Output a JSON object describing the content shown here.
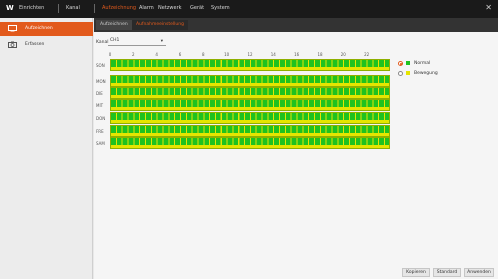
{
  "topnav": {
    "logo": "W",
    "items": [
      "Einrichten",
      "Kanal",
      "Aufzeichnung",
      "Alarm",
      "Netzwerk",
      "Gerät",
      "System"
    ],
    "active": "Aufzeichnung",
    "close_icon": "close-icon"
  },
  "sidebar": {
    "items": [
      {
        "label": "Aufzeichnen",
        "icon": "record-icon",
        "active": true
      },
      {
        "label": "Erfassen",
        "icon": "camera-icon",
        "active": false
      }
    ]
  },
  "subtabs": [
    {
      "label": "Aufzeichnen",
      "active": false
    },
    {
      "label": "Aufnahmeeinstellung",
      "active": true
    }
  ],
  "schedule": {
    "channel_label": "Kanal",
    "channel_value": "CH1",
    "hours": [
      "0",
      "2",
      "4",
      "6",
      "8",
      "10",
      "12",
      "14",
      "16",
      "18",
      "20",
      "22"
    ],
    "days": [
      "SON",
      "MON",
      "DIE",
      "MIT",
      "DON",
      "FRE",
      "SAM"
    ]
  },
  "legend": [
    {
      "label": "Normal",
      "color": "#1fc21f",
      "selected": true
    },
    {
      "label": "Bewegung",
      "color": "#e5e500",
      "selected": false
    }
  ],
  "footer": {
    "copy": "Kopieren",
    "default": "Standard",
    "apply": "Anwenden"
  },
  "colors": {
    "accent": "#e25a1c",
    "normal": "#1fc21f",
    "motion": "#e5e500"
  }
}
